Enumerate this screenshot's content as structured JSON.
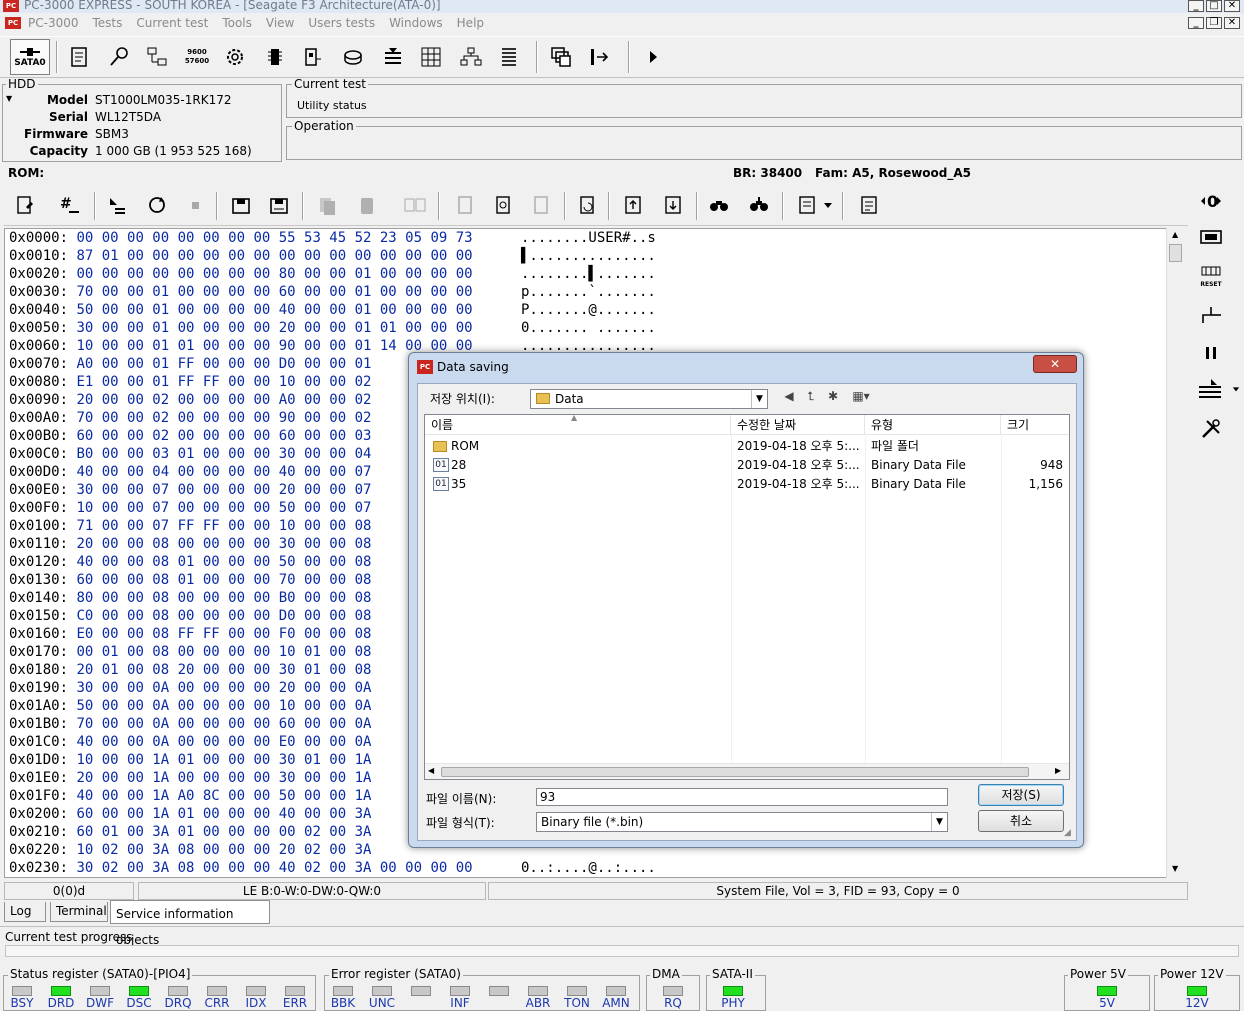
{
  "window": {
    "title": "PC-3000 EXPRESS - SOUTH KOREA - [Seagate F3 Architecture(ATA-0)]",
    "app_icon_text": "PC"
  },
  "menu": {
    "items": [
      "PC-3000",
      "Tests",
      "Current test",
      "Tools",
      "View",
      "Users tests",
      "Windows",
      "Help"
    ]
  },
  "toolbar1": {
    "port_label": "SATA0",
    "baud_icon_text": "9600 57600"
  },
  "hdd": {
    "group_label": "HDD",
    "model_label": "Model",
    "model": "ST1000LM035-1RK172",
    "serial_label": "Serial",
    "serial": "WL12T5DA",
    "firmware_label": "Firmware",
    "firmware": "SBM3",
    "capacity_label": "Capacity",
    "capacity": "1 000 GB (1 953 525 168)"
  },
  "current_test": {
    "group_label": "Current test",
    "value": "Utility status"
  },
  "operation": {
    "group_label": "Operation",
    "value": ""
  },
  "rom_bar": {
    "label": "ROM:",
    "br": "BR: 38400",
    "fam": "Fam: A5, Rosewood_A5"
  },
  "hex": {
    "rows": [
      {
        "addr": "0x0000:",
        "bytes": "00 00 00 00 00 00 00 00 55 53 45 52 23 05 09 73",
        "ascii": "........USER#..s"
      },
      {
        "addr": "0x0010:",
        "bytes": "87 01 00 00 00 00 00 00 00 00 00 00 00 00 00 00",
        "ascii": "▌..............."
      },
      {
        "addr": "0x0020:",
        "bytes": "00 00 00 00 00 00 00 00 80 00 00 01 00 00 00 00",
        "ascii": "........▌......."
      },
      {
        "addr": "0x0030:",
        "bytes": "70 00 00 01 00 00 00 00 60 00 00 01 00 00 00 00",
        "ascii": "p.......`......."
      },
      {
        "addr": "0x0040:",
        "bytes": "50 00 00 01 00 00 00 00 40 00 00 01 00 00 00 00",
        "ascii": "P.......@......."
      },
      {
        "addr": "0x0050:",
        "bytes": "30 00 00 01 00 00 00 00 20 00 00 01 01 00 00 00",
        "ascii": "0....... ......."
      },
      {
        "addr": "0x0060:",
        "bytes": "10 00 00 01 01 00 00 00 90 00 00 01 14 00 00 00",
        "ascii": "................"
      },
      {
        "addr": "0x0070:",
        "bytes": "A0 00 00 01 FF 00 00 00 D0 00 00 01",
        "ascii": ""
      },
      {
        "addr": "0x0080:",
        "bytes": "E1 00 00 01 FF FF 00 00 10 00 00 02",
        "ascii": ""
      },
      {
        "addr": "0x0090:",
        "bytes": "20 00 00 02 00 00 00 00 A0 00 00 02",
        "ascii": ""
      },
      {
        "addr": "0x00A0:",
        "bytes": "70 00 00 02 00 00 00 00 90 00 00 02",
        "ascii": ""
      },
      {
        "addr": "0x00B0:",
        "bytes": "60 00 00 02 00 00 00 00 60 00 00 03",
        "ascii": ""
      },
      {
        "addr": "0x00C0:",
        "bytes": "B0 00 00 03 01 00 00 00 30 00 00 04",
        "ascii": ""
      },
      {
        "addr": "0x00D0:",
        "bytes": "40 00 00 04 00 00 00 00 40 00 00 07",
        "ascii": ""
      },
      {
        "addr": "0x00E0:",
        "bytes": "30 00 00 07 00 00 00 00 20 00 00 07",
        "ascii": ""
      },
      {
        "addr": "0x00F0:",
        "bytes": "10 00 00 07 00 00 00 00 50 00 00 07",
        "ascii": ""
      },
      {
        "addr": "0x0100:",
        "bytes": "71 00 00 07 FF FF 00 00 10 00 00 08",
        "ascii": ""
      },
      {
        "addr": "0x0110:",
        "bytes": "20 00 00 08 00 00 00 00 30 00 00 08",
        "ascii": ""
      },
      {
        "addr": "0x0120:",
        "bytes": "40 00 00 08 01 00 00 00 50 00 00 08",
        "ascii": ""
      },
      {
        "addr": "0x0130:",
        "bytes": "60 00 00 08 01 00 00 00 70 00 00 08",
        "ascii": ""
      },
      {
        "addr": "0x0140:",
        "bytes": "80 00 00 08 00 00 00 00 B0 00 00 08",
        "ascii": ""
      },
      {
        "addr": "0x0150:",
        "bytes": "C0 00 00 08 00 00 00 00 D0 00 00 08",
        "ascii": ""
      },
      {
        "addr": "0x0160:",
        "bytes": "E0 00 00 08 FF FF 00 00 F0 00 00 08",
        "ascii": ""
      },
      {
        "addr": "0x0170:",
        "bytes": "00 01 00 08 00 00 00 00 10 01 00 08",
        "ascii": ""
      },
      {
        "addr": "0x0180:",
        "bytes": "20 01 00 08 20 00 00 00 30 01 00 08",
        "ascii": ""
      },
      {
        "addr": "0x0190:",
        "bytes": "30 00 00 0A 00 00 00 00 20 00 00 0A",
        "ascii": ""
      },
      {
        "addr": "0x01A0:",
        "bytes": "50 00 00 0A 00 00 00 00 10 00 00 0A",
        "ascii": ""
      },
      {
        "addr": "0x01B0:",
        "bytes": "70 00 00 0A 00 00 00 00 60 00 00 0A",
        "ascii": ""
      },
      {
        "addr": "0x01C0:",
        "bytes": "40 00 00 0A 00 00 00 00 E0 00 00 0A",
        "ascii": ""
      },
      {
        "addr": "0x01D0:",
        "bytes": "10 00 00 1A 01 00 00 00 30 01 00 1A",
        "ascii": ""
      },
      {
        "addr": "0x01E0:",
        "bytes": "20 00 00 1A 00 00 00 00 30 00 00 1A",
        "ascii": ""
      },
      {
        "addr": "0x01F0:",
        "bytes": "40 00 00 1A A0 8C 00 00 50 00 00 1A",
        "ascii": ""
      },
      {
        "addr": "0x0200:",
        "bytes": "60 00 00 1A 01 00 00 00 40 00 00 3A",
        "ascii": ""
      },
      {
        "addr": "0x0210:",
        "bytes": "60 01 00 3A 01 00 00 00 00 02 00 3A",
        "ascii": ""
      },
      {
        "addr": "0x0220:",
        "bytes": "10 02 00 3A 08 00 00 00 20 02 00 3A",
        "ascii": ""
      },
      {
        "addr": "0x0230:",
        "bytes": "30 02 00 3A 08 00 00 00 40 02 00 3A 00 00 00 00",
        "ascii": "0..:....@..:...."
      }
    ]
  },
  "status_bar": {
    "pos": "0(0)d",
    "le": "LE B:0-W:0-DW:0-QW:0",
    "file": "System File, Vol = 3, FID = 93, Copy = 0"
  },
  "tabs": [
    "Log",
    "Terminal",
    "Service information objects"
  ],
  "progress": {
    "label": "Current test progress",
    "value_fraction": 0
  },
  "registers": {
    "status": {
      "label": "Status register (SATA0)-[PIO4]",
      "leds": [
        {
          "name": "BSY",
          "on": false
        },
        {
          "name": "DRD",
          "on": true
        },
        {
          "name": "DWF",
          "on": false
        },
        {
          "name": "DSC",
          "on": true
        },
        {
          "name": "DRQ",
          "on": false
        },
        {
          "name": "CRR",
          "on": false
        },
        {
          "name": "IDX",
          "on": false
        },
        {
          "name": "ERR",
          "on": false
        }
      ]
    },
    "error": {
      "label": "Error register (SATA0)",
      "leds": [
        {
          "name": "BBK",
          "on": false
        },
        {
          "name": "UNC",
          "on": false
        },
        {
          "name": "",
          "on": false
        },
        {
          "name": "INF",
          "on": false
        },
        {
          "name": "",
          "on": false
        },
        {
          "name": "ABR",
          "on": false
        },
        {
          "name": "TON",
          "on": false
        },
        {
          "name": "AMN",
          "on": false
        }
      ]
    },
    "dma": {
      "label": "DMA",
      "leds": [
        {
          "name": "RQ",
          "on": false
        }
      ]
    },
    "sata": {
      "label": "SATA-II",
      "leds": [
        {
          "name": "PHY",
          "on": true
        }
      ]
    },
    "power5": {
      "label": "Power 5V",
      "leds": [
        {
          "name": "5V",
          "on": true
        }
      ]
    },
    "power12": {
      "label": "Power 12V",
      "leds": [
        {
          "name": "12V",
          "on": true
        }
      ]
    }
  },
  "sidebar": {
    "reset_text": "RESET"
  },
  "dialog": {
    "title": "Data saving",
    "icon_text": "PC",
    "close_glyph": "✕",
    "location_label": "저장 위치(I):",
    "location_value": "Data",
    "columns": [
      "이름",
      "수정한 날짜",
      "유형",
      "크기"
    ],
    "files": [
      {
        "icon": "folder",
        "name": "ROM",
        "date": "2019-04-18 오후 5:...",
        "type": "파일 폴더",
        "size": ""
      },
      {
        "icon": "bin",
        "name": "28",
        "date": "2019-04-18 오후 5:...",
        "type": "Binary Data File",
        "size": "948"
      },
      {
        "icon": "bin",
        "name": "35",
        "date": "2019-04-18 오후 5:...",
        "type": "Binary Data File",
        "size": "1,156"
      }
    ],
    "filename_label": "파일 이름(N):",
    "filename_value": "93",
    "filetype_label": "파일 형식(T):",
    "filetype_value": "Binary file (*.bin)",
    "save_button": "저장(S)",
    "cancel_button": "취소",
    "bin_icon_text": "01"
  },
  "colors": {
    "hex_bytes": "#0a2aa3",
    "led_on": "#20e020",
    "led_label": "#1a37b0"
  }
}
